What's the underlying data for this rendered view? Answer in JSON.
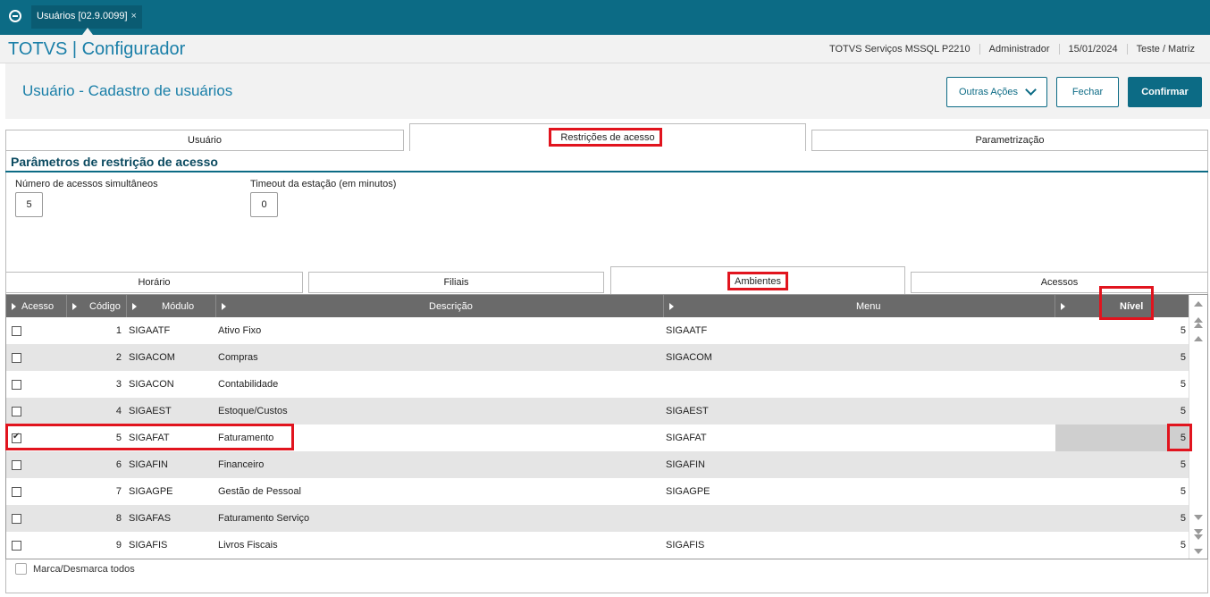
{
  "topbar": {
    "tab_label": "Usuários [02.9.0099]",
    "tab_close": "×"
  },
  "header": {
    "app_title": "TOTVS | Configurador",
    "info": [
      "TOTVS Serviços MSSQL P2210",
      "Administrador",
      "15/01/2024",
      "Teste / Matriz"
    ]
  },
  "page": {
    "title": "Usuário - Cadastro de usuários",
    "btn_outras": "Outras Ações",
    "btn_fechar": "Fechar",
    "btn_confirmar": "Confirmar"
  },
  "tabs1": [
    "Usuário",
    "Restrições de acesso",
    "Parametrização"
  ],
  "section": {
    "title": "Parâmetros de restrição de acesso",
    "field1_label": "Número de acessos simultâneos",
    "field1_value": "5",
    "field2_label": "Timeout da estação (em minutos)",
    "field2_value": "0"
  },
  "tabs2": [
    "Horário",
    "Filiais",
    "Ambientes",
    "Acessos"
  ],
  "grid": {
    "columns": [
      "Acesso",
      "Código",
      "Módulo",
      "Descrição",
      "Menu",
      "Nível"
    ],
    "rows": [
      {
        "checked": false,
        "codigo": "1",
        "modulo": "SIGAATF",
        "descricao": "Ativo Fixo",
        "menu": "SIGAATF",
        "nivel": "5"
      },
      {
        "checked": false,
        "codigo": "2",
        "modulo": "SIGACOM",
        "descricao": "Compras",
        "menu": "SIGACOM",
        "nivel": "5"
      },
      {
        "checked": false,
        "codigo": "3",
        "modulo": "SIGACON",
        "descricao": "Contabilidade",
        "menu": "",
        "nivel": "5"
      },
      {
        "checked": false,
        "codigo": "4",
        "modulo": "SIGAEST",
        "descricao": "Estoque/Custos",
        "menu": "SIGAEST",
        "nivel": "5"
      },
      {
        "checked": true,
        "codigo": "5",
        "modulo": "SIGAFAT",
        "descricao": "Faturamento",
        "menu": "SIGAFAT",
        "nivel": "5"
      },
      {
        "checked": false,
        "codigo": "6",
        "modulo": "SIGAFIN",
        "descricao": "Financeiro",
        "menu": "SIGAFIN",
        "nivel": "5"
      },
      {
        "checked": false,
        "codigo": "7",
        "modulo": "SIGAGPE",
        "descricao": "Gestão de Pessoal",
        "menu": "SIGAGPE",
        "nivel": "5"
      },
      {
        "checked": false,
        "codigo": "8",
        "modulo": "SIGAFAS",
        "descricao": "Faturamento Serviço",
        "menu": "",
        "nivel": "5"
      },
      {
        "checked": false,
        "codigo": "9",
        "modulo": "SIGAFIS",
        "descricao": "Livros Fiscais",
        "menu": "SIGAFIS",
        "nivel": "5"
      }
    ]
  },
  "footer": {
    "select_all_label": "Marca/Desmarca todos"
  },
  "colors": {
    "brand": "#0c6b85",
    "title": "#1a7fa8",
    "highlight": "#e1141e"
  }
}
